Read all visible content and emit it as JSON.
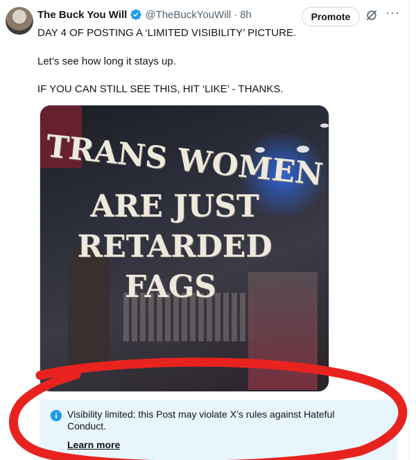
{
  "tweet": {
    "display_name": "The Buck You Will",
    "handle": "@TheBuckYouWill",
    "separator": "·",
    "time": "8h",
    "promote_label": "Promote",
    "more_icon_glyph": "···",
    "lines": [
      "DAY 4 OF POSTING A ‘LIMITED VISIBILITY’ PICTURE.",
      "Let’s see how long it stays up.",
      "IF YOU CAN STILL SEE THIS, HIT ‘LIKE’ - THANKS."
    ],
    "verified_color": "#1d9bf0"
  },
  "media": {
    "sign_lines": [
      "TRANS WOMEN",
      "ARE JUST",
      "RETARDED",
      "FAGS"
    ]
  },
  "notice": {
    "text": "Visibility limited: this Post may violate X’s rules against Hateful Conduct.",
    "link_label": "Learn more",
    "icon": "info-icon",
    "background": "#e8f5fd"
  },
  "annotation": {
    "shape": "hand-drawn red ellipse",
    "color": "#e8231f"
  }
}
